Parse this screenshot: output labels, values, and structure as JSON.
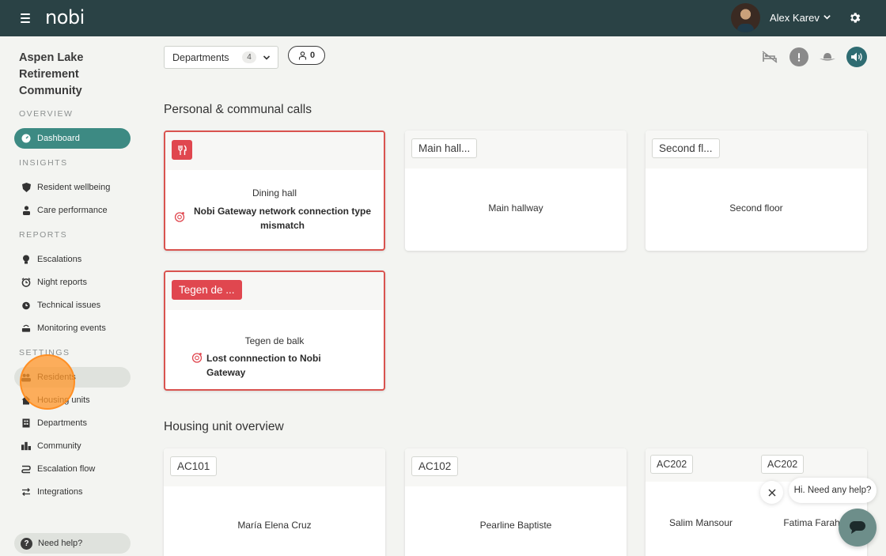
{
  "app": {
    "logo": "nobi"
  },
  "user": {
    "name": "Alex Karev"
  },
  "sidebar": {
    "community": "Aspen Lake Retirement Community",
    "sections": {
      "overview": "OVERVIEW",
      "insights": "INSIGHTS",
      "reports": "REPORTS",
      "settings": "SETTINGS"
    },
    "items": {
      "dashboard": "Dashboard",
      "resident_wellbeing": "Resident wellbeing",
      "care_performance": "Care performance",
      "escalations": "Escalations",
      "night_reports": "Night reports",
      "technical_issues": "Technical issues",
      "monitoring_events": "Monitoring events",
      "residents": "Residents",
      "housing_units": "Housing units",
      "departments": "Departments",
      "community": "Community",
      "escalation_flow": "Escalation flow",
      "integrations": "Integrations"
    },
    "help": "Need help?"
  },
  "toolbar": {
    "departments_label": "Departments",
    "departments_count": "4",
    "residents_count": "0"
  },
  "calls": {
    "title": "Personal & communal calls",
    "cards": [
      {
        "name": "Dining hall",
        "message": "Nobi Gateway network connection type mismatch"
      },
      {
        "tag": "Main hall...",
        "name": "Main hallway"
      },
      {
        "tag": "Second fl...",
        "name": "Second floor"
      },
      {
        "tag": "Tegen de ...",
        "name": "Tegen de balk",
        "message": "Lost connnection to Nobi Gateway"
      }
    ]
  },
  "housing": {
    "title": "Housing unit overview",
    "cards": [
      {
        "tag": "AC101",
        "name": "María Elena Cruz"
      },
      {
        "tag": "AC102",
        "name": "Pearline Baptiste"
      },
      {
        "tag_a": "AC202",
        "name_a": "Salim Mansour",
        "tag_b": "AC202",
        "name_b": "Fatima Farah"
      }
    ]
  },
  "chat": {
    "greeting": "Hi. Need any help?"
  },
  "colors": {
    "topbar": "#2a4245",
    "accent": "#3d8a83",
    "alert": "#e0474f"
  }
}
